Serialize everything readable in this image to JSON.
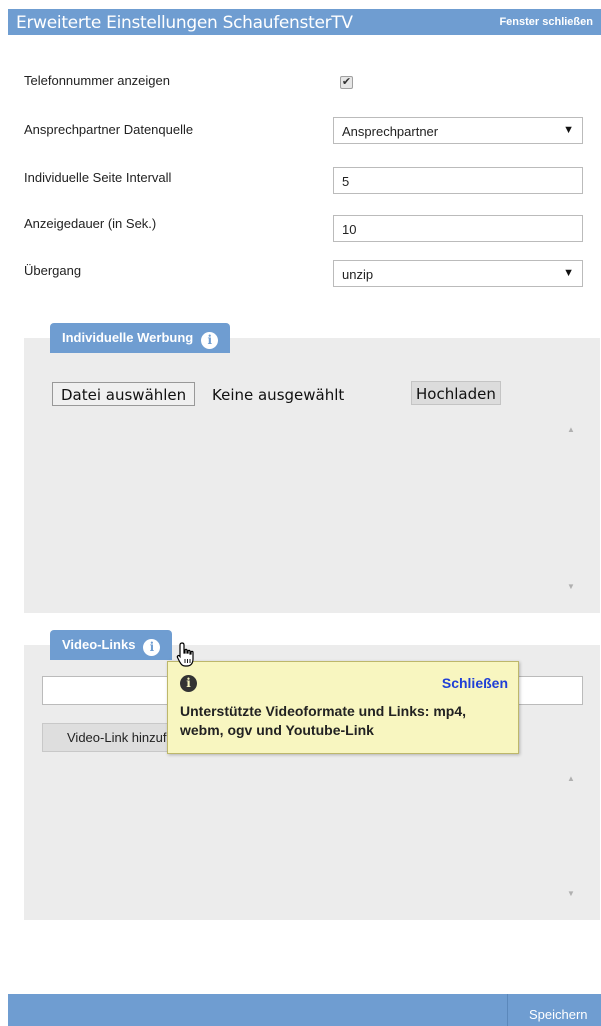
{
  "window": {
    "title": "Erweiterte Einstellungen SchaufensterTV",
    "close_label": "Fenster schließen"
  },
  "settings": {
    "phone_label": "Telefonnummer anzeigen",
    "phone_checked": true,
    "phone_checkmark": "✔",
    "source_label": "Ansprechpartner Datenquelle",
    "source_value": "Ansprechpartner",
    "interval_label": "Individuelle Seite Intervall",
    "interval_value": "5",
    "duration_label": "Anzeigedauer (in Sek.)",
    "duration_value": "10",
    "transition_label": "Übergang",
    "transition_value": "unzip",
    "dropdown_caret": "▼"
  },
  "ad_panel": {
    "tab_label": "Individuelle Werbung",
    "info_glyph": "i",
    "file_button": "Datei auswählen",
    "file_status": "Keine ausgewählt",
    "upload_button": "Hochladen",
    "scroll_up": "▲",
    "scroll_down": "▼"
  },
  "video_panel": {
    "tab_label": "Video-Links",
    "info_glyph": "i",
    "add_button": "Video-Link hinzufügen",
    "scroll_up": "▲",
    "scroll_down": "▼"
  },
  "tooltip": {
    "info_glyph": "i",
    "close_label": "Schließen",
    "text": "Unterstützte Videoformate und Links: mp4, webm, ogv und Youtube-Link"
  },
  "footer": {
    "save_label": "Speichern"
  },
  "colors": {
    "accent": "#6f9dd1",
    "panel_bg": "#ececec",
    "tooltip_bg": "#f8f6c0",
    "link": "#1f3fd6"
  }
}
